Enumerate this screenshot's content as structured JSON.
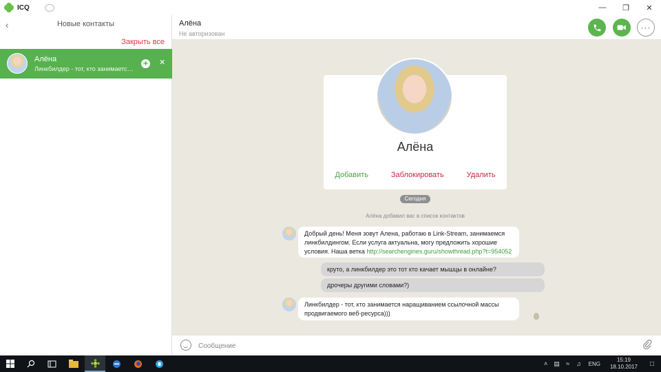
{
  "app": {
    "title": "ICQ"
  },
  "window_controls": {
    "minimize": "—",
    "restore": "❐",
    "close": "✕"
  },
  "sidebar": {
    "title": "Новые контакты",
    "close_all": "Закрыть все",
    "contacts": [
      {
        "name": "Алёна",
        "preview": "Линкбилдер - тот, кто занимается наращиванием ссылочной массы"
      }
    ]
  },
  "chat_header": {
    "name": "Алёна",
    "status": "Не авторизован",
    "more_label": "···"
  },
  "profile_card": {
    "name": "Алёна",
    "add_label": "Добавить",
    "block_label": "Заблокировать",
    "delete_label": "Удалить"
  },
  "date_separator": "Сегодня",
  "system_message": "Алёна  добавил вас в список контактов",
  "messages": [
    {
      "direction": "in",
      "text": "Добрый день! Меня зовут Алена, работаю в Link-Stream, занимаемся линкбилдингом. Если услуга актуальна, могу предложить хорошие условия. Наша ветка ",
      "link": "http://searchengines.guru/showthread.php?t=954052"
    },
    {
      "direction": "out",
      "text": "круто, а линкбилдер это тот кто качает мышцы в онлайне?"
    },
    {
      "direction": "out",
      "text": "дрочеры другими словами?)"
    },
    {
      "direction": "in",
      "text": "Линкбилдер - тот, кто занимается наращиванием ссылочной массы продвигаемого веб-ресурса)))"
    }
  ],
  "composer": {
    "placeholder": "Сообщение"
  },
  "taskbar": {
    "lang": "ENG",
    "time": "15:19",
    "date": "18.10.2017"
  },
  "colors": {
    "accent_green": "#56b14e",
    "danger_red": "#c42a42",
    "chat_bg": "#ebe8e0",
    "link_green": "#3d9c3a"
  },
  "icons": [
    "icq-logo-icon",
    "back-icon",
    "add-contact-icon",
    "close-icon",
    "phone-icon",
    "video-icon",
    "more-icon",
    "emoji-icon",
    "attach-icon",
    "windows-start-icon",
    "search-icon"
  ]
}
